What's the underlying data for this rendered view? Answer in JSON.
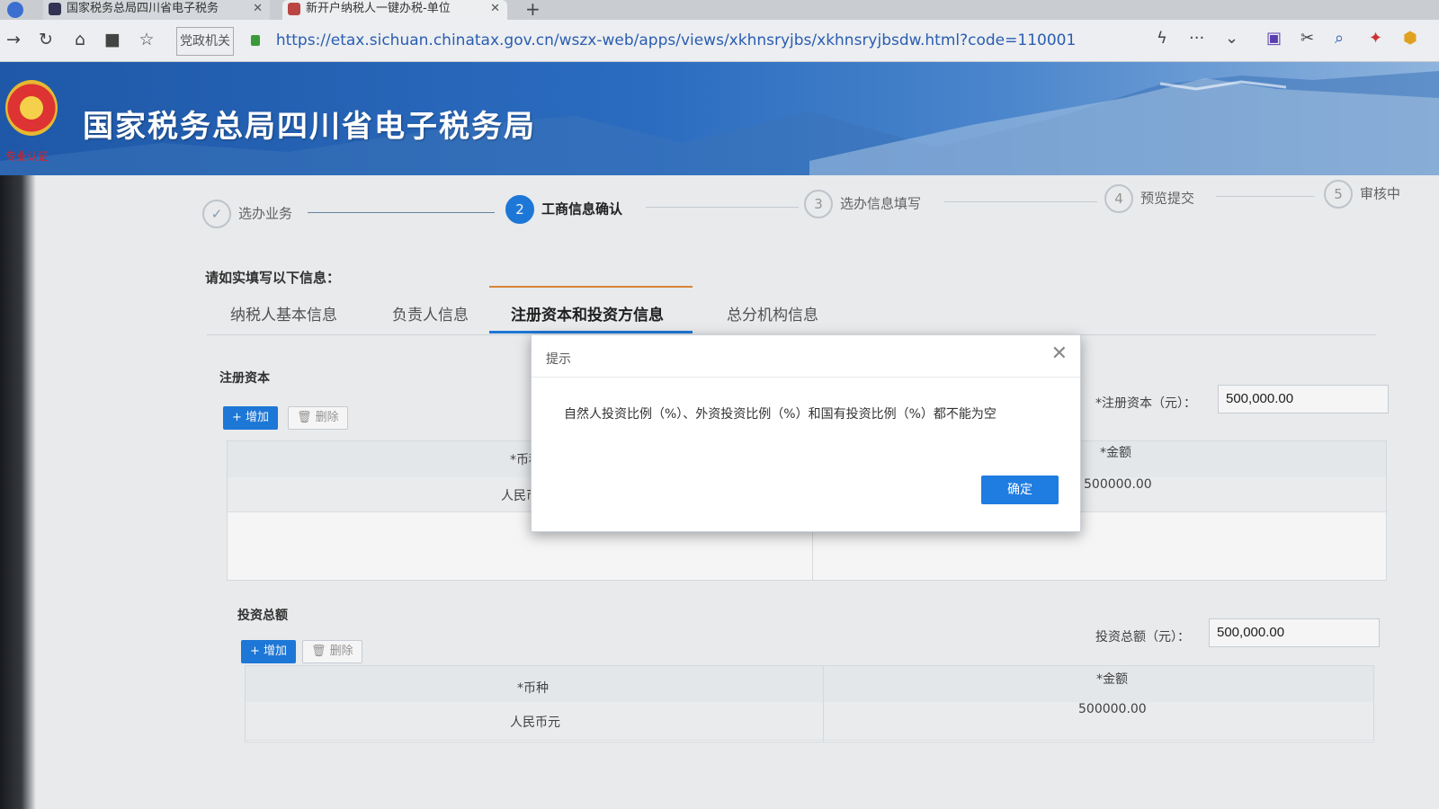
{
  "browser": {
    "tabs": [
      {
        "label": "国家税务总局四川省电子税务",
        "close": "✕"
      },
      {
        "label": "新开户纳税人一键办税-单位",
        "close": "✕"
      }
    ],
    "new_tab": "+",
    "site_badge": "党政机关",
    "url": "https://etax.sichuan.chinatax.gov.cn/wszx-web/apps/views/xkhnsryjbs/xkhnsryjbsdw.html?code=110001"
  },
  "header": {
    "title": "国家税务总局四川省电子税务局",
    "emblem_caption": "专业认证"
  },
  "steps": [
    {
      "num": "✓",
      "label": "选办业务",
      "state": "done"
    },
    {
      "num": "2",
      "label": "工商信息确认",
      "state": "active"
    },
    {
      "num": "3",
      "label": "选办信息填写",
      "state": "todo"
    },
    {
      "num": "4",
      "label": "预览提交",
      "state": "todo"
    },
    {
      "num": "5",
      "label": "审核中",
      "state": "todo"
    }
  ],
  "prompt": "请如实填写以下信息：",
  "page_tabs": [
    {
      "label": "纳税人基本信息"
    },
    {
      "label": "负责人信息"
    },
    {
      "label": "注册资本和投资方信息",
      "active": true
    },
    {
      "label": "总分机构信息"
    }
  ],
  "registered_capital": {
    "section_label": "注册资本",
    "add_label": "+ 增加",
    "delete_label": "删除",
    "header_currency": "*币种",
    "header_amount": "*金额",
    "row_currency": "人民币元",
    "row_amount": "500000.00",
    "total_label": "*注册资本（元）：",
    "total_value": "500,000.00"
  },
  "investment_total": {
    "section_label": "投资总额",
    "add_label": "+ 增加",
    "delete_label": "删除",
    "header_currency": "*币种",
    "header_amount": "*金额",
    "row_currency": "人民币元",
    "row_amount": "500000.00",
    "total_label": "投资总额（元）：",
    "total_value": "500,000.00"
  },
  "modal": {
    "title": "提示",
    "close": "✕",
    "message": "自然人投资比例（%）、外资投资比例（%）和国有投资比例（%）都不能为空",
    "ok_label": "确定"
  },
  "colors": {
    "primary": "#1f7ce0",
    "header_blue": "#2b6cc0",
    "tab_accent": "#e08a3a"
  }
}
